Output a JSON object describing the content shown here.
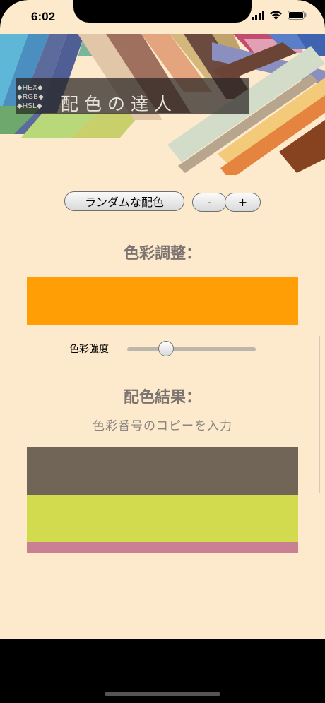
{
  "status_bar": {
    "time": "6:02"
  },
  "banner": {
    "formats": [
      "◆HEX◆",
      "◆RGB◆",
      "◆HSL◆"
    ],
    "title": "配色の達人"
  },
  "toolbar": {
    "random_label": "ランダムな配色",
    "minus_label": "-",
    "plus_label": "+"
  },
  "adjust": {
    "heading": "色彩調整：",
    "swatch_color": "#ff9f05",
    "slider_label": "色彩強度",
    "slider_value": 0.3
  },
  "result": {
    "heading": "配色結果：",
    "hint": "色彩番号のコピーを入力",
    "colors": [
      "#716558",
      "#d2da4e",
      "#c98092"
    ]
  }
}
